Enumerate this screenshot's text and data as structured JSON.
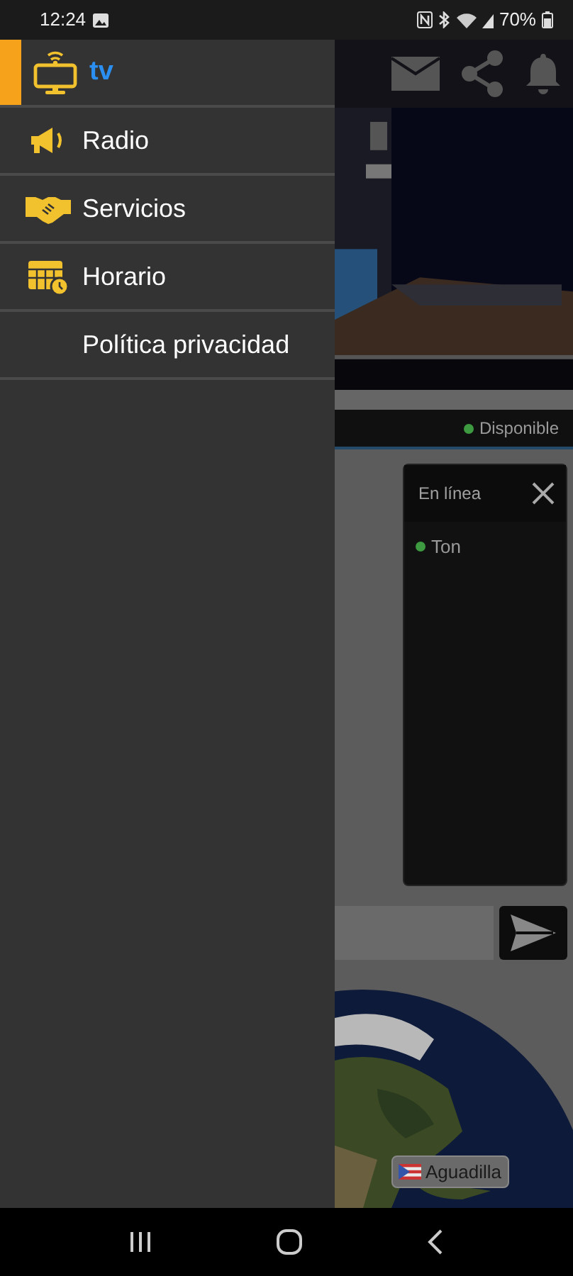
{
  "status_bar": {
    "time": "12:24",
    "battery": "70%"
  },
  "drawer": {
    "title": "tv",
    "items": [
      {
        "label": "Radio",
        "kind": "radio"
      },
      {
        "label": "Servicios",
        "kind": "services"
      },
      {
        "label": "Horario",
        "kind": "schedule"
      },
      {
        "label": "Política privacidad",
        "kind": "plain"
      }
    ]
  },
  "presence": {
    "label": "Disponible",
    "color": "#3d9a40"
  },
  "online_panel": {
    "title": "En línea",
    "users": [
      {
        "name": "Ton",
        "color": "#3d9a40"
      }
    ]
  },
  "map": {
    "marker_label": "Aguadilla"
  }
}
